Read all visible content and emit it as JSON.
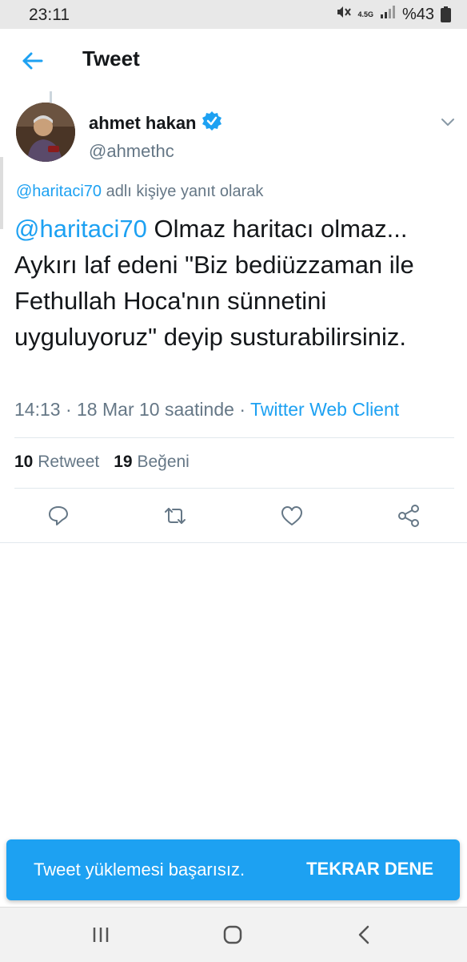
{
  "status": {
    "time": "23:11",
    "network": "4.5G",
    "battery": "%43"
  },
  "appbar": {
    "title": "Tweet"
  },
  "author": {
    "display_name": "ahmet hakan",
    "handle": "@ahmethc",
    "verified": true
  },
  "reply_context": {
    "mention": "@haritaci70",
    "suffix": " adlı kişiye yanıt olarak"
  },
  "tweet": {
    "mention": "@haritaci70",
    "text": " Olmaz haritacı olmaz... Aykırı laf edeni \"Biz bediüzzaman ile Fethullah Hoca'nın sünnetini uyguluyoruz\" deyip susturabilirsiniz.",
    "time": "14:13",
    "separator": "·",
    "date": "18 Mar 10 saatinde",
    "client": "Twitter Web Client"
  },
  "stats": {
    "retweet_count": "10",
    "retweet_label": "Retweet",
    "like_count": "19",
    "like_label": "Beğeni"
  },
  "actions": [
    "reply-icon",
    "retweet-icon",
    "like-icon",
    "share-icon"
  ],
  "snackbar": {
    "message": "Tweet yüklemesi başarısız.",
    "action": "TEKRAR DENE"
  },
  "colors": {
    "accent": "#1da1f2",
    "secondary_text": "#657786",
    "primary_text": "#14171a"
  }
}
